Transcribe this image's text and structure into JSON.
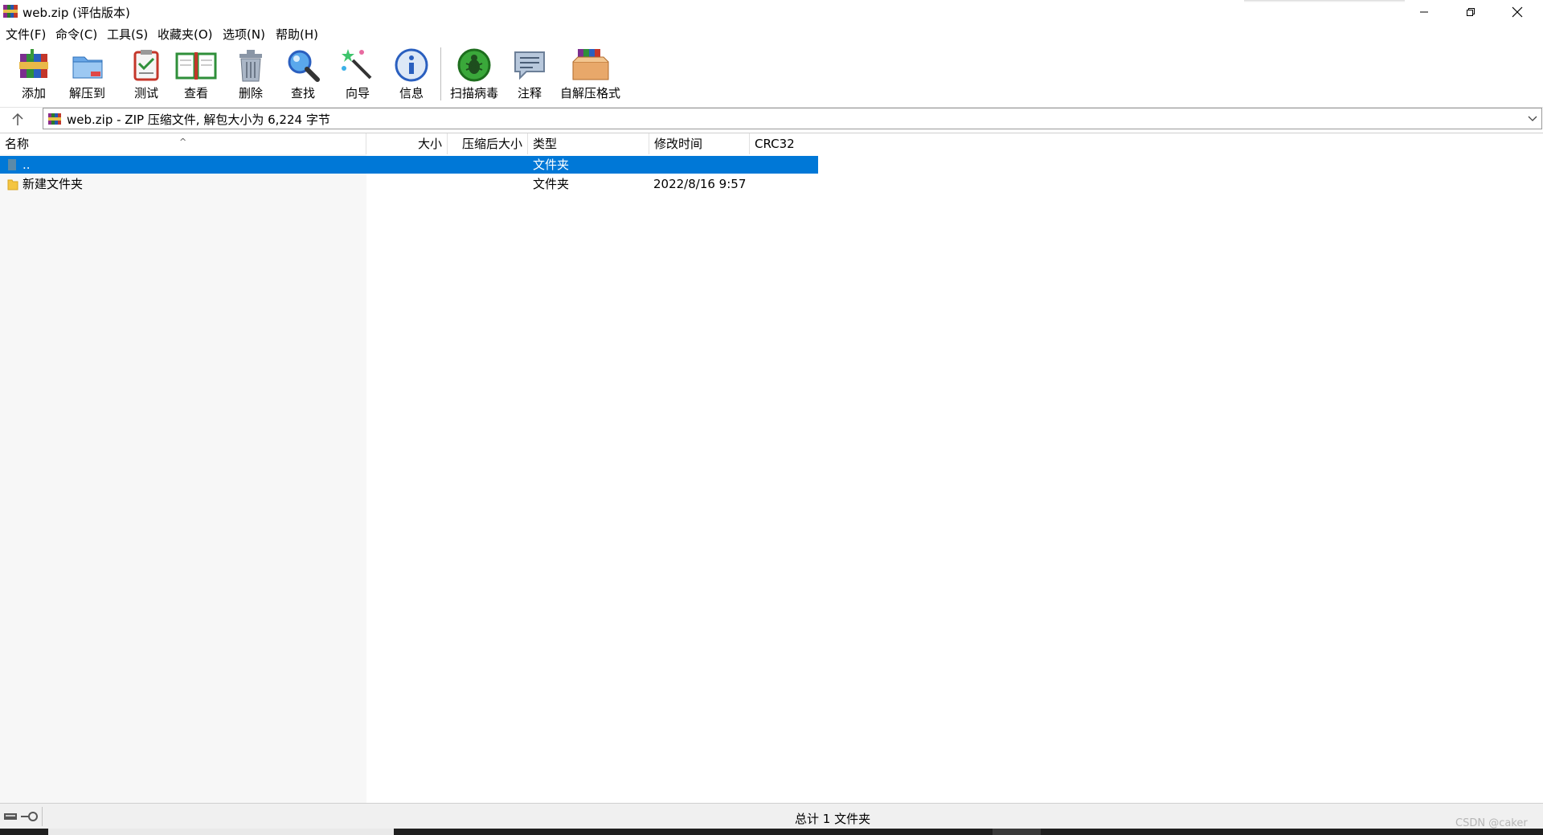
{
  "window": {
    "title": "web.zip (评估版本)",
    "controls": {
      "minimize_icon": "minimize-icon",
      "restore_icon": "restore-icon",
      "close_icon": "close-icon"
    }
  },
  "menu": {
    "items": [
      "文件(F)",
      "命令(C)",
      "工具(S)",
      "收藏夹(O)",
      "选项(N)",
      "帮助(H)"
    ]
  },
  "toolbar": {
    "buttons": [
      {
        "label": "添加",
        "icon": "add-archive-icon"
      },
      {
        "label": "解压到",
        "icon": "extract-to-icon"
      },
      {
        "label": "测试",
        "icon": "test-icon"
      },
      {
        "label": "查看",
        "icon": "view-book-icon"
      },
      {
        "label": "删除",
        "icon": "trash-icon"
      },
      {
        "label": "查找",
        "icon": "magnifier-icon"
      },
      {
        "label": "向导",
        "icon": "wizard-wand-icon"
      },
      {
        "label": "信息",
        "icon": "info-icon"
      },
      {
        "label": "扫描病毒",
        "icon": "virus-scan-icon"
      },
      {
        "label": "注释",
        "icon": "comment-icon"
      },
      {
        "label": "自解压格式",
        "icon": "sfx-box-icon"
      }
    ]
  },
  "address": {
    "text": "web.zip - ZIP 压缩文件, 解包大小为 6,224 字节"
  },
  "columns": {
    "name": "名称",
    "size": "大小",
    "packed": "压缩后大小",
    "type": "类型",
    "modified": "修改时间",
    "crc": "CRC32"
  },
  "rows": [
    {
      "name": "..",
      "size": "",
      "packed": "",
      "type": "文件夹",
      "modified": "",
      "crc": "",
      "selected": true,
      "icon": "parent-folder-icon"
    },
    {
      "name": "新建文件夹",
      "size": "",
      "packed": "",
      "type": "文件夹",
      "modified": "2022/8/16 9:57",
      "crc": "",
      "selected": false,
      "icon": "folder-icon"
    }
  ],
  "status": {
    "text": "总计 1 文件夹",
    "watermark": "CSDN @caker"
  },
  "colors": {
    "selection": "#0078d7",
    "status_bg": "#f0f0f0",
    "name_col_bg": "#f7f7f7"
  }
}
